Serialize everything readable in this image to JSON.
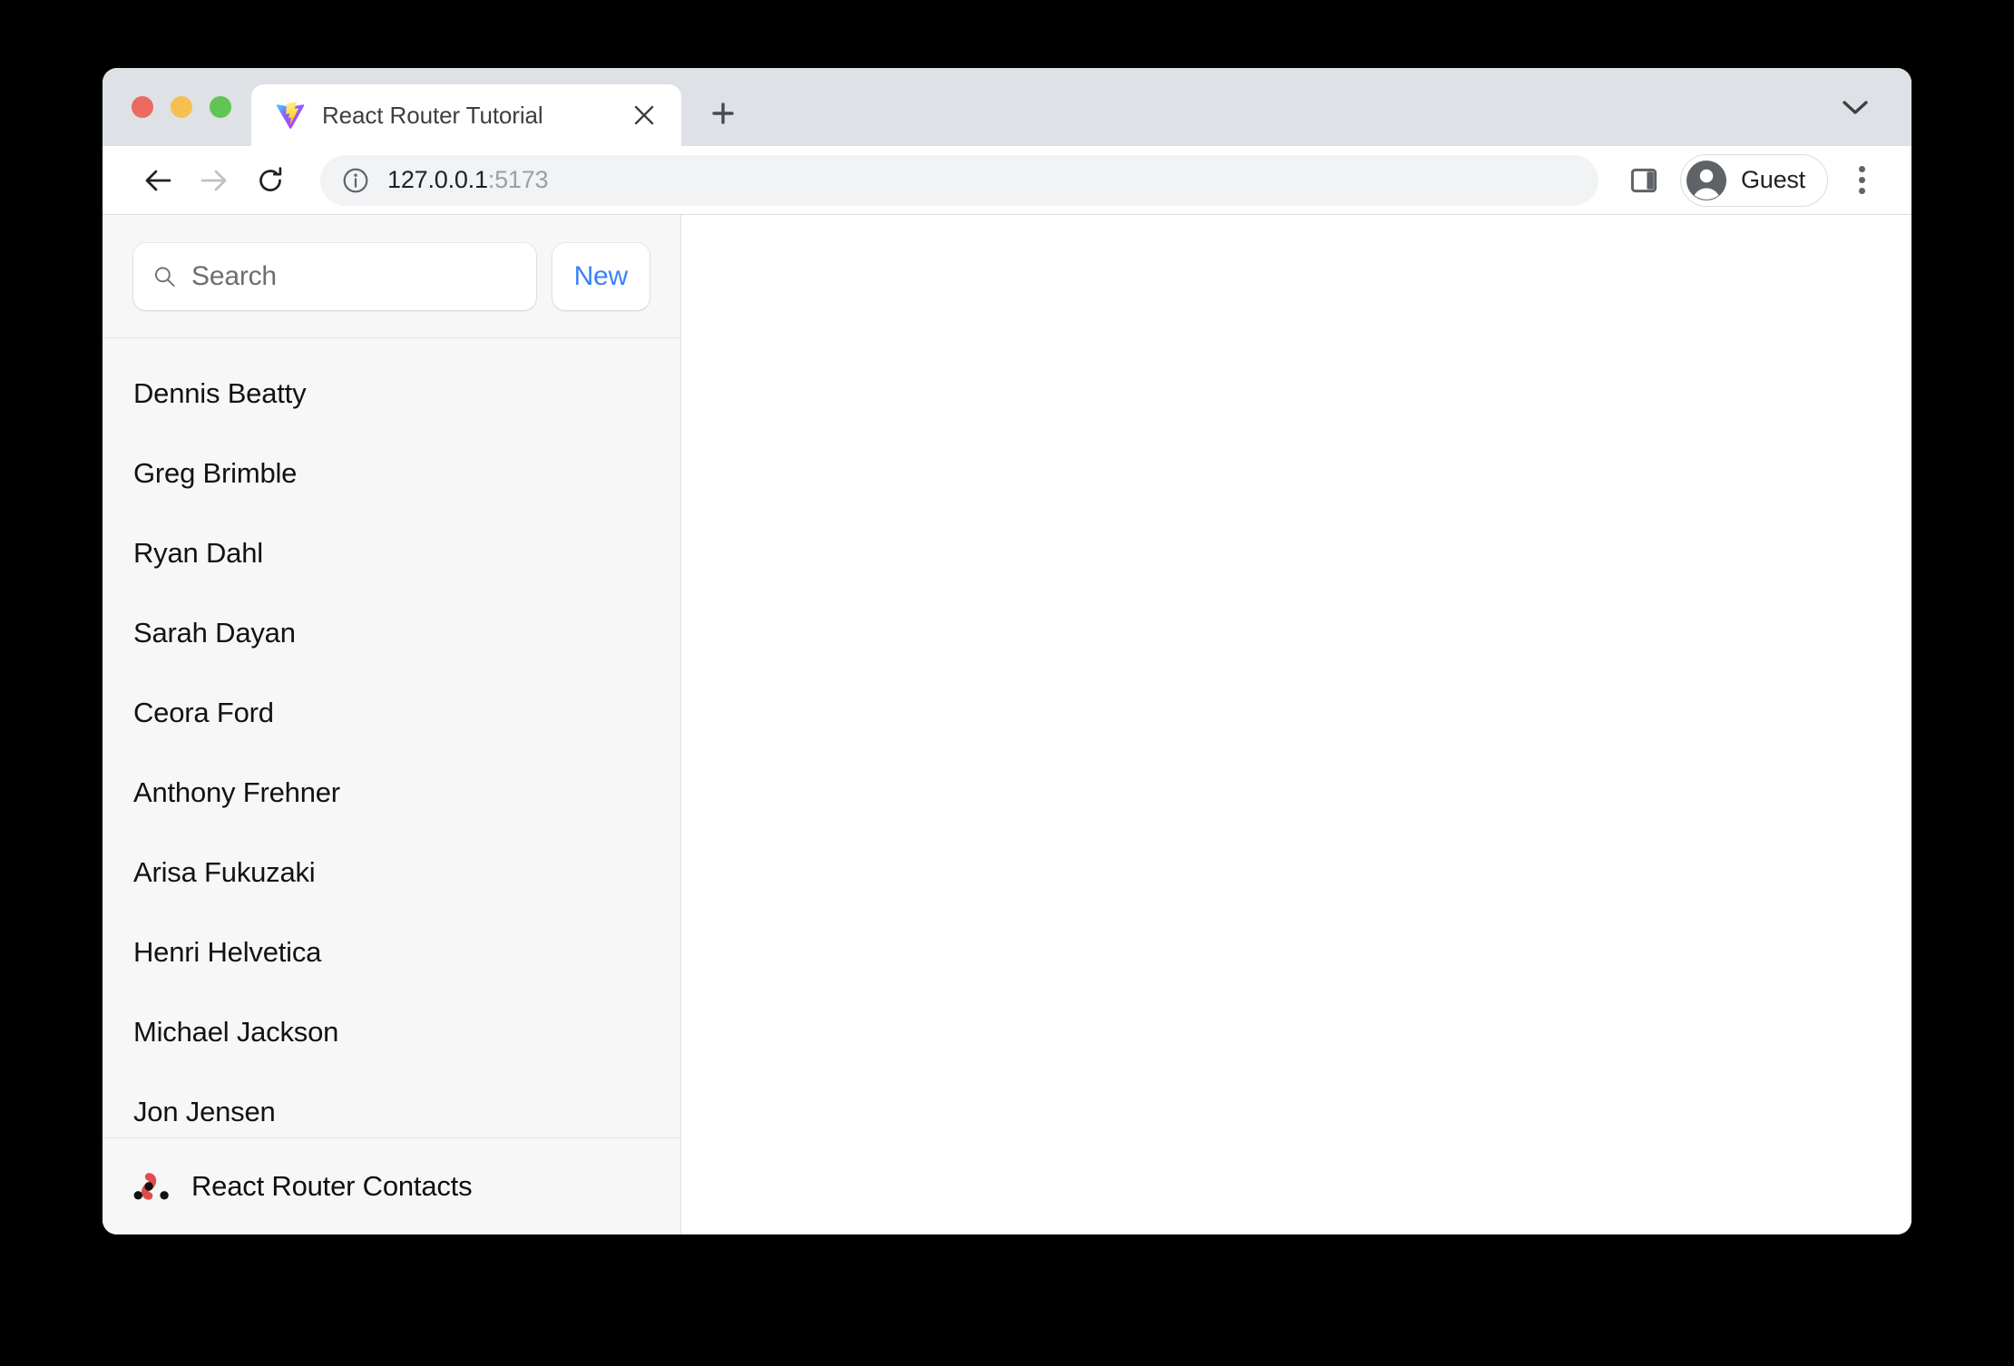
{
  "browser": {
    "tab": {
      "title": "React Router Tutorial",
      "favicon": "vite-logo-icon",
      "close_icon": "close-icon"
    },
    "new_tab_icon": "plus-icon",
    "tab_list_chevron_icon": "chevron-down-icon",
    "toolbar": {
      "back_icon": "arrow-left-icon",
      "forward_icon": "arrow-right-icon",
      "reload_icon": "reload-icon",
      "site_info_icon": "info-circle-icon",
      "url_host": "127.0.0.1",
      "url_port": ":5173",
      "side_panel_icon": "side-panel-icon",
      "profile_icon": "account-circle-icon",
      "profile_name": "Guest",
      "menu_icon": "kebab-menu-icon"
    }
  },
  "app": {
    "sidebar": {
      "search": {
        "placeholder": "Search",
        "value": "",
        "icon": "search-icon"
      },
      "new_button_label": "New",
      "contacts": [
        {
          "name": "Dennis Beatty"
        },
        {
          "name": "Greg Brimble"
        },
        {
          "name": "Ryan Dahl"
        },
        {
          "name": "Sarah Dayan"
        },
        {
          "name": "Ceora Ford"
        },
        {
          "name": "Anthony Frehner"
        },
        {
          "name": "Arisa Fukuzaki"
        },
        {
          "name": "Henri Helvetica"
        },
        {
          "name": "Michael Jackson"
        },
        {
          "name": "Jon Jensen"
        }
      ],
      "footer": {
        "logo": "react-router-logo-icon",
        "label": "React Router Contacts"
      }
    },
    "main": {
      "content": ""
    }
  },
  "colors": {
    "accent_blue": "#3b82f6",
    "sidebar_bg": "#f7f7f7",
    "tabstrip_bg": "#dee1e6",
    "logo_red": "#e04b4b"
  }
}
